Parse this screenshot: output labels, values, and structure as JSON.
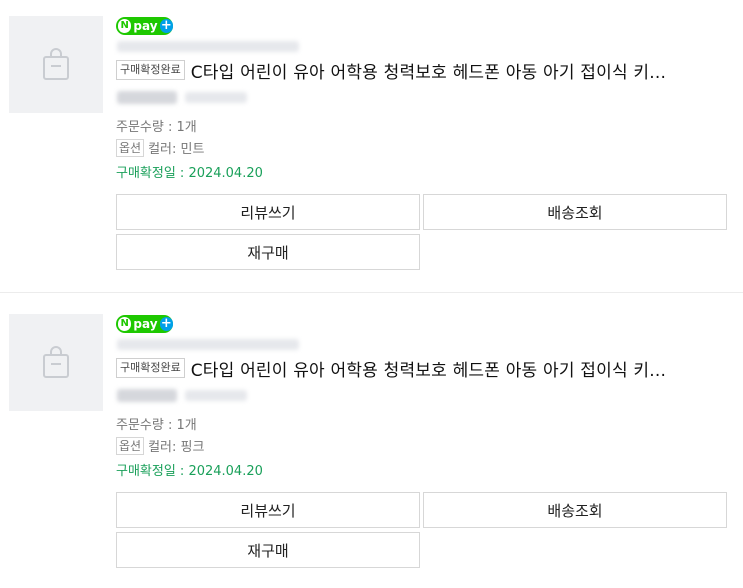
{
  "orders": [
    {
      "payment_badge": {
        "label": "pay",
        "n": "N",
        "plus": "+"
      },
      "status_badge": "구매확정완료",
      "title": "C타입 어린이 유아 어학용 청력보호 헤드폰 아동 아기 접이식 키...",
      "quantity": "주문수량 : 1개",
      "option_tag": "옵션",
      "option_value": "컬러: 민트",
      "confirm_date": "구매확정일 : 2024.04.20",
      "buttons": {
        "review": "리뷰쓰기",
        "shipping": "배송조회",
        "rebuy": "재구매"
      }
    },
    {
      "payment_badge": {
        "label": "pay",
        "n": "N",
        "plus": "+"
      },
      "status_badge": "구매확정완료",
      "title": "C타입 어린이 유아 어학용 청력보호 헤드폰 아동 아기 접이식 키...",
      "quantity": "주문수량 : 1개",
      "option_tag": "옵션",
      "option_value": "컬러: 핑크",
      "confirm_date": "구매확정일 : 2024.04.20",
      "buttons": {
        "review": "리뷰쓰기",
        "shipping": "배송조회",
        "rebuy": "재구매"
      }
    }
  ],
  "colors": {
    "npay_green": "#1ec800",
    "plus_blue": "#00a0e9",
    "confirm_green": "#1aa05a"
  },
  "icons": {
    "thumbnail": "shopping-bag-placeholder-icon"
  }
}
